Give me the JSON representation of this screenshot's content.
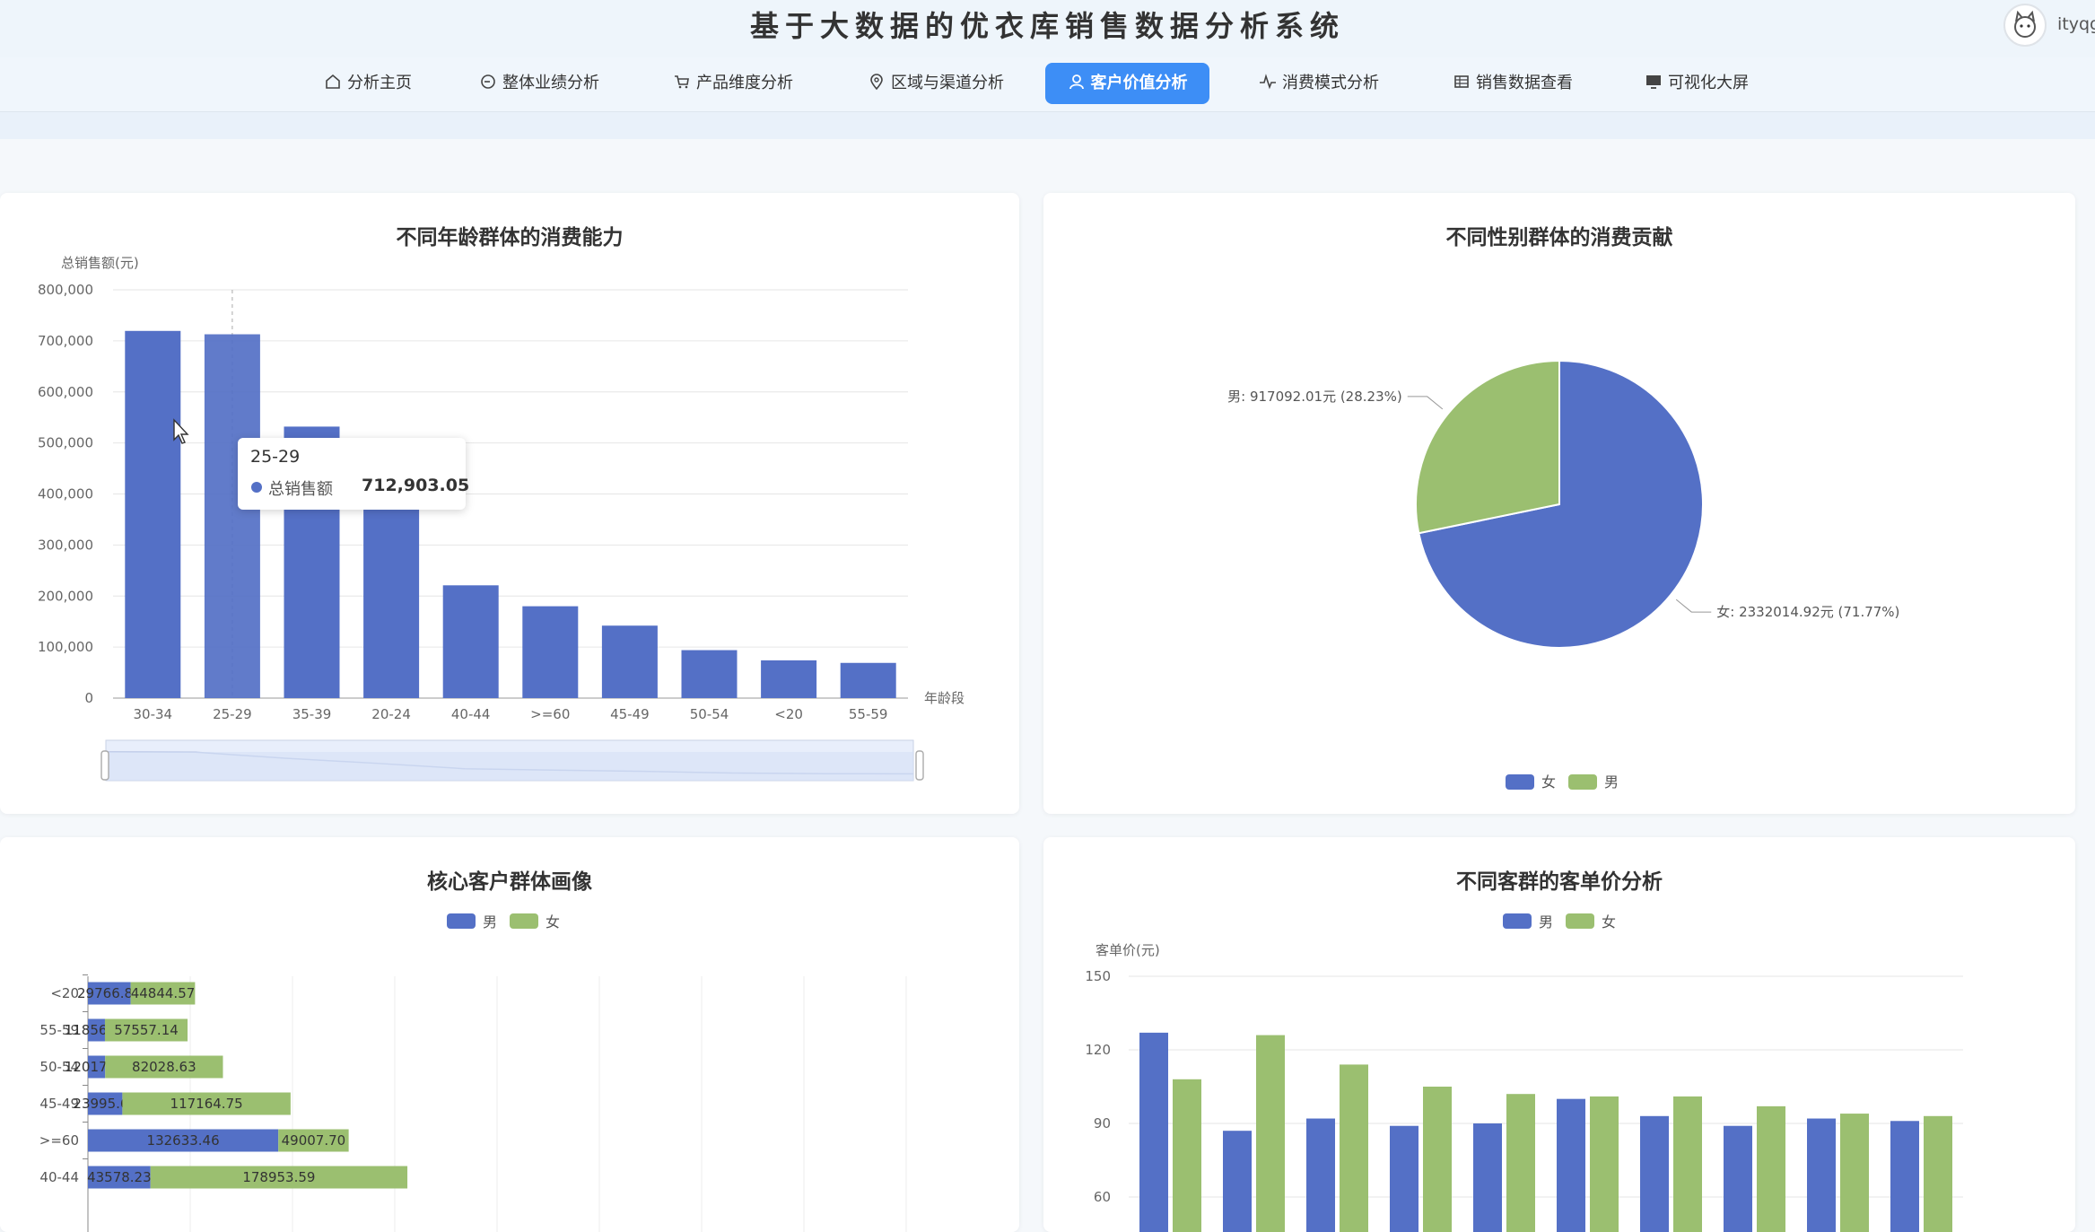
{
  "app": {
    "title": "基于大数据的优衣库销售数据分析系统",
    "username": "ityqg"
  },
  "nav": {
    "items": [
      {
        "label": "分析主页",
        "icon": "home-icon"
      },
      {
        "label": "整体业绩分析",
        "icon": "refresh-icon"
      },
      {
        "label": "产品维度分析",
        "icon": "cart-icon"
      },
      {
        "label": "区域与渠道分析",
        "icon": "location-pin-icon"
      },
      {
        "label": "客户价值分析",
        "icon": "user-icon",
        "active": true
      },
      {
        "label": "消费模式分析",
        "icon": "pulse-icon"
      },
      {
        "label": "销售数据查看",
        "icon": "table-icon"
      },
      {
        "label": "可视化大屏",
        "icon": "monitor-icon"
      }
    ]
  },
  "colors": {
    "accent": "#3d8ef6",
    "blue_series": "#5470c6",
    "green_series": "#9bbf70"
  },
  "tooltip": {
    "category": "25-29",
    "series": "总销售额",
    "value": "712,903.05"
  },
  "chart_data": [
    {
      "type": "bar",
      "title": "不同年龄群体的消费能力",
      "ylabel": "总销售额(元)",
      "xlabel": "年龄段",
      "categories": [
        "30-34",
        "25-29",
        "35-39",
        "20-24",
        "40-44",
        ">=60",
        "45-49",
        "50-54",
        "<20",
        "55-59"
      ],
      "values": [
        719500,
        712903.05,
        532000,
        385000,
        221000,
        180000,
        142000,
        94000,
        74000,
        69000
      ],
      "ylim": [
        0,
        800000
      ],
      "yticks": [
        "0",
        "100,000",
        "200,000",
        "300,000",
        "400,000",
        "500,000",
        "600,000",
        "700,000",
        "800,000"
      ],
      "grid": true,
      "datazoom": true
    },
    {
      "type": "pie",
      "title": "不同性别群体的消费贡献",
      "slices": [
        {
          "name": "女",
          "value": 2332014.92,
          "label": "女: 2332014.92元 (71.77%)"
        },
        {
          "name": "男",
          "value": 917092.01,
          "label": "男: 917092.01元 (28.23%)"
        }
      ],
      "legend": [
        "女",
        "男"
      ],
      "legend_position": "bottom"
    },
    {
      "type": "bar",
      "orientation": "horizontal",
      "stacked": true,
      "title": "核心客户群体画像",
      "legend": [
        "男",
        "女"
      ],
      "categories": [
        "<20",
        "55-59",
        "50-54",
        "45-49",
        ">=60",
        "40-44"
      ],
      "series": [
        {
          "name": "男",
          "values": [
            29766.88,
            11856.75,
            12017.82,
            23995.62,
            132633.46,
            43578.23
          ],
          "labels": [
            "29766.88",
            "11856.75",
            "12017.82",
            "23995.62",
            "132633.46",
            "43578.23"
          ]
        },
        {
          "name": "女",
          "values": [
            44844.57,
            57557.14,
            82028.63,
            117164.75,
            49007.7,
            178953.59
          ],
          "labels": [
            "44844.57",
            "57557.14",
            "82028.63",
            "117164.75",
            "49007.70",
            "178953.59"
          ]
        }
      ]
    },
    {
      "type": "bar",
      "title": "不同客群的客单价分析",
      "ylabel": "客单价(元)",
      "legend": [
        "男",
        "女"
      ],
      "yticks": [
        "60",
        "90",
        "120",
        "150"
      ],
      "ylim": [
        60,
        150
      ],
      "series": [
        {
          "name": "男",
          "values": [
            127,
            87,
            92,
            89,
            90,
            100,
            93,
            89,
            92,
            91
          ]
        },
        {
          "name": "女",
          "values": [
            108,
            126,
            114,
            105,
            102,
            101,
            101,
            97,
            94,
            93
          ]
        }
      ]
    }
  ]
}
